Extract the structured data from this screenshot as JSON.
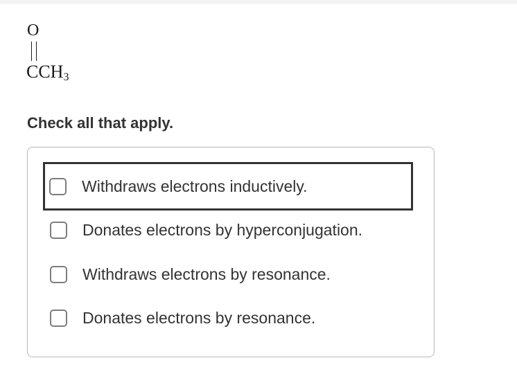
{
  "formula": {
    "oxygen": "O",
    "group_main": "CCH",
    "group_subscript": "3"
  },
  "instruction": "Check all that apply.",
  "options": [
    {
      "label": "Withdraws electrons inductively.",
      "checked": false,
      "focused": true
    },
    {
      "label": "Donates electrons by hyperconjugation.",
      "checked": false,
      "focused": false
    },
    {
      "label": "Withdraws electrons by resonance.",
      "checked": false,
      "focused": false
    },
    {
      "label": "Donates electrons by resonance.",
      "checked": false,
      "focused": false
    }
  ]
}
